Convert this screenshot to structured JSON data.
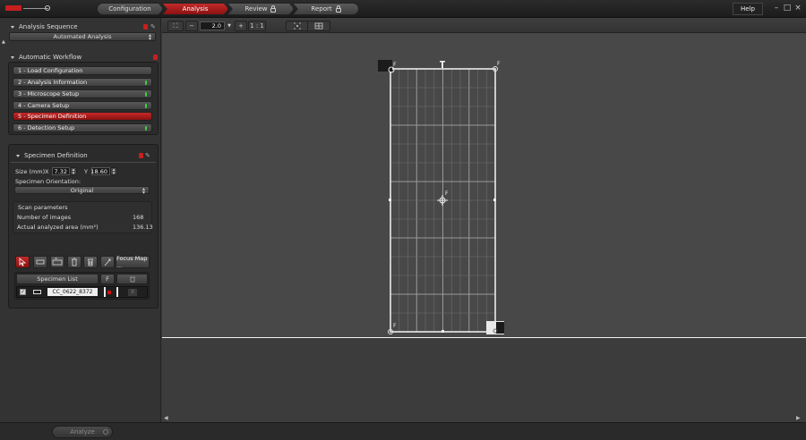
{
  "topbar": {
    "steps": [
      {
        "label": "Configuration",
        "active": false,
        "locked": false
      },
      {
        "label": "Analysis",
        "active": true,
        "locked": false
      },
      {
        "label": "Review",
        "active": false,
        "locked": true
      },
      {
        "label": "Report",
        "active": false,
        "locked": true
      }
    ],
    "help_label": "Help"
  },
  "analysis_sequence": {
    "title": "Analysis Sequence",
    "selected": "Automated Analysis"
  },
  "workflow": {
    "title": "Automatic Workflow",
    "items": [
      {
        "label": "1 - Load Configuration",
        "active": false,
        "status": "none"
      },
      {
        "label": "2 - Analysis Information",
        "active": false,
        "status": "ok"
      },
      {
        "label": "3 - Microscope Setup",
        "active": false,
        "status": "ok"
      },
      {
        "label": "4 - Camera Setup",
        "active": false,
        "status": "ok"
      },
      {
        "label": "5 - Specimen Definition",
        "active": true,
        "status": "none"
      },
      {
        "label": "6 - Detection Setup",
        "active": false,
        "status": "ok"
      }
    ]
  },
  "specimen": {
    "title": "Specimen Definition",
    "size_label": "Size (mm)",
    "x_label": "X",
    "x_value": "7.32",
    "y_label": "Y",
    "y_value": "18.60",
    "orientation_label": "Specimen Orientation:",
    "orientation_value": "Original",
    "scan_title": "Scan parameters",
    "num_images_label": "Number of images",
    "num_images_value": "168",
    "area_label": "Actual analyzed area (mm²)",
    "area_value": "136.13",
    "focus_map_label": "Focus Map ...",
    "list_header": "Specimen List",
    "list_flag_header": "F",
    "list_rows": [
      {
        "name": "CC_0622_8372",
        "checked": true,
        "delete_label": "X"
      }
    ]
  },
  "viewer": {
    "zoom_value": "2.0",
    "zoom_minus": "−",
    "zoom_plus": "+",
    "zoom_one": "1 : 1",
    "grid_cols": 12,
    "grid_rows": 14,
    "corner_label": "F"
  },
  "bottom": {
    "analyze_label": "Analyze"
  }
}
